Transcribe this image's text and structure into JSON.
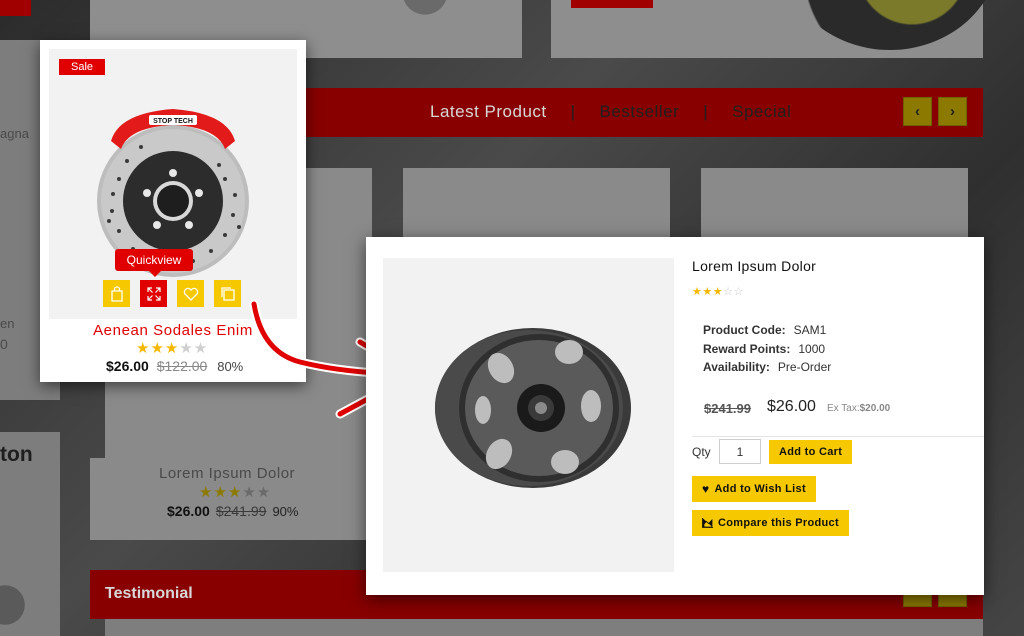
{
  "background": {
    "tabs": [
      "Latest Product",
      "|",
      "Bestseller",
      "|",
      "Special"
    ],
    "bestseller_tab": "Bestseller",
    "special_tab": "Special",
    "left_cut_text_1": "agna",
    "left_cut_text_2": "en",
    "left_cut_text_3": "0",
    "left_heading_cut": "ton",
    "product_name": "Lorem Ipsum Dolor",
    "product_price": "$26.00",
    "product_old_price": "$241.99",
    "product_discount": "90%",
    "product_rating": 3,
    "testimonial_heading": "Testimonial"
  },
  "card": {
    "sale_label": "Sale",
    "quickview_tooltip": "Quickview",
    "title": "Aenean Sodales Enim",
    "rating": 3,
    "price": "$26.00",
    "old_price": "$122.00",
    "discount": "80%",
    "caliper_brand": "STOP TECH"
  },
  "quickview": {
    "title": "Lorem Ipsum Dolor",
    "rating": 3,
    "product_code_label": "Product Code:",
    "product_code": "SAM1",
    "reward_points_label": "Reward Points:",
    "reward_points": "1000",
    "availability_label": "Availability:",
    "availability": "Pre-Order",
    "old_price": "$241.99",
    "price": "$26.00",
    "ex_tax_label": "Ex Tax:",
    "ex_tax_value": "$20.00",
    "qty_label": "Qty",
    "qty_value": "1",
    "add_to_cart": "Add to Cart",
    "add_to_wishlist": "Add to Wish List",
    "compare": "Compare this Product"
  },
  "colors": {
    "accent_red": "#e00000",
    "accent_yellow": "#f6c800",
    "star": "#f6b800"
  }
}
